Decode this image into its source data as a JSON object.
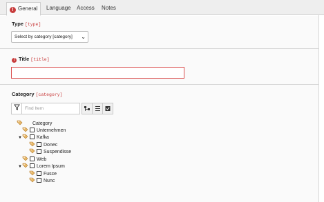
{
  "tabs": [
    {
      "label": "General",
      "active": true,
      "error": true
    },
    {
      "label": "Language"
    },
    {
      "label": "Access"
    },
    {
      "label": "Notes"
    }
  ],
  "fields": {
    "type": {
      "label": "Type",
      "key": "[type]",
      "value": "Select by category [category]"
    },
    "title": {
      "label": "Title",
      "key": "[title]",
      "value": "",
      "error": true
    },
    "category": {
      "label": "Category",
      "key": "[category]"
    }
  },
  "filter": {
    "placeholder": "Find Item"
  },
  "tree": {
    "root": "Category",
    "items": [
      {
        "label": "Unternehmen",
        "level": 1
      },
      {
        "label": "Kafka",
        "level": 1,
        "expanded": true
      },
      {
        "label": "Donec",
        "level": 2
      },
      {
        "label": "Suspendisse",
        "level": 2
      },
      {
        "label": "Web",
        "level": 1
      },
      {
        "label": "Lorem Ipsum",
        "level": 1,
        "expanded": true
      },
      {
        "label": "Fusce",
        "level": 2
      },
      {
        "label": "Nunc",
        "level": 2
      }
    ]
  },
  "colors": {
    "error": "#c83c3c",
    "accent_tag": "#d9a35b"
  }
}
